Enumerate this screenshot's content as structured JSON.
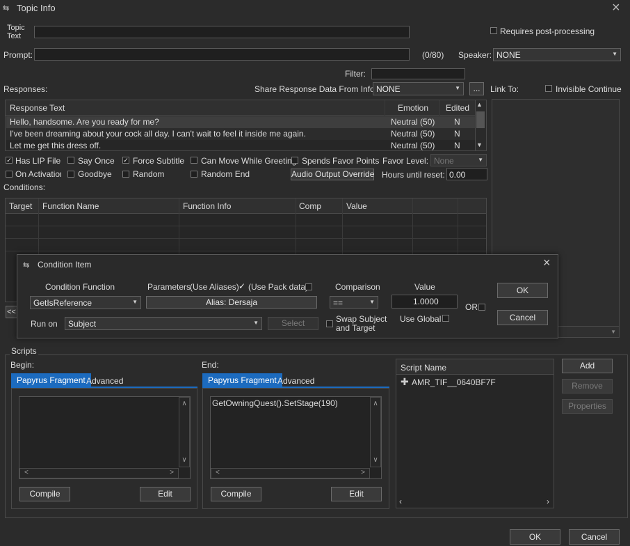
{
  "window": {
    "title": "Topic Info",
    "close": "×"
  },
  "topic": {
    "label_line1": "Topic",
    "label_line2": "Text",
    "requires_post": "Requires post-processing"
  },
  "prompt": {
    "label": "Prompt:",
    "count": "(0/80)",
    "speaker_label": "Speaker:",
    "speaker_value": "NONE"
  },
  "filter": {
    "label": "Filter:"
  },
  "responses": {
    "label": "Responses:",
    "share_label": "Share Response Data From Info:",
    "share_value": "NONE",
    "share_btn": "...",
    "link_to": "Link To:",
    "invisible_continue": "Invisible Continue",
    "columns": [
      "Response Text",
      "Emotion",
      "Edited"
    ],
    "rows": [
      {
        "text": "Hello, handsome. Are you ready for me?",
        "emotion": "Neutral (50)",
        "edited": "N"
      },
      {
        "text": "I've been dreaming about your cock all day. I can't wait to feel it inside me again.",
        "emotion": "Neutral (50)",
        "edited": "N"
      },
      {
        "text": "Let me get this dress off.",
        "emotion": "Neutral (50)",
        "edited": "N"
      }
    ]
  },
  "flags": {
    "has_lip": "Has LIP File",
    "say_once": "Say Once",
    "force_subtitle": "Force Subtitle",
    "can_move": "Can Move While Greeting",
    "spends_favor": "Spends Favor Points",
    "favor_level_label": "Favor Level:",
    "favor_level_value": "None",
    "on_activation": "On Activatior",
    "goodbye": "Goodbye",
    "random": "Random",
    "random_end": "Random End",
    "audio_override": "Audio Output Override",
    "hours_label": "Hours until reset:",
    "hours_value": "0.00"
  },
  "conditions": {
    "label": "Conditions:",
    "columns": [
      "Target",
      "Function Name",
      "Function Info",
      "Comp",
      "Value"
    ],
    "prev_btn": "<<"
  },
  "dialog": {
    "title": "Condition Item",
    "close": "×",
    "func_label": "Condition Function",
    "func_value": "GetIsReference",
    "params_label": "Parameters",
    "use_aliases": "(Use Aliases)",
    "use_pack": "(Use Pack data)",
    "param_value": "Alias: Dersaja",
    "comparison_label": "Comparison",
    "comparison_value": "==",
    "value_label": "Value",
    "value": "1.0000",
    "or_label": "OR",
    "ok": "OK",
    "cancel": "Cancel",
    "run_on_label": "Run on",
    "run_on_value": "Subject",
    "select_btn": "Select",
    "swap_line1": "Swap Subject",
    "swap_line2": "and Target",
    "use_global": "Use Global"
  },
  "scripts": {
    "label": "Scripts",
    "begin_label": "Begin:",
    "end_label": "End:",
    "tab_papyrus": "Papyrus Fragment",
    "tab_advanced": "Advanced",
    "end_code": "GetOwningQuest().SetStage(190)",
    "compile": "Compile",
    "edit": "Edit",
    "script_name_header": "Script Name",
    "script_item": "AMR_TIF__0640BF7F",
    "add": "Add",
    "remove": "Remove",
    "properties": "Properties"
  },
  "footer": {
    "ok": "OK",
    "cancel": "Cancel"
  },
  "colors": {
    "accent": "#1c6bbf",
    "background": "#2b2b2b"
  }
}
